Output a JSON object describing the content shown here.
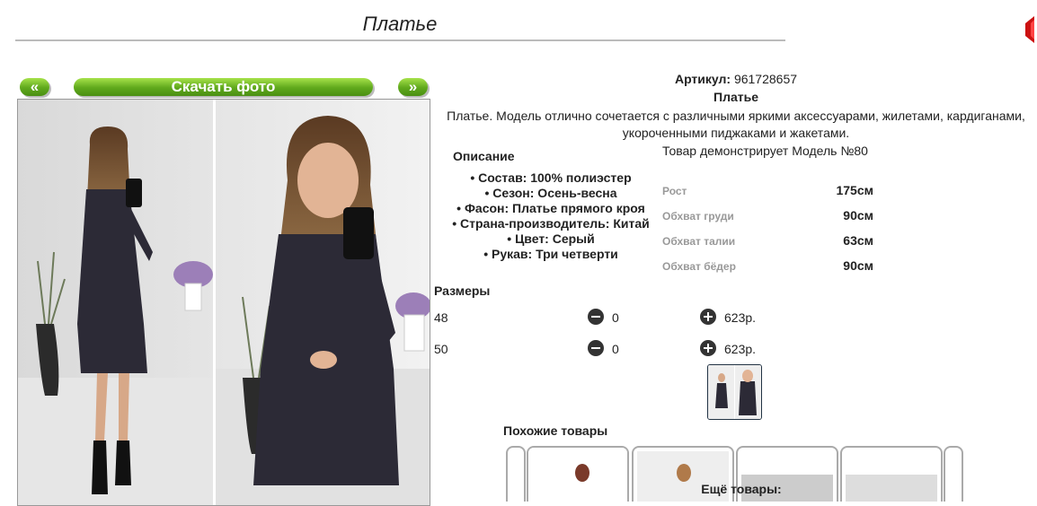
{
  "page": {
    "title": "Платье"
  },
  "gallery": {
    "prev_label": "«",
    "download_label": "Скачать фото",
    "next_label": "»"
  },
  "product": {
    "article_label": "Артикул:",
    "article_value": "961728657",
    "name": "Платье",
    "description_line1": "Платье. Модель отлично сочетается с различными яркими аксессуарами, жилетами, кардиганами,",
    "description_line2": "укороченными пиджаками и жакетами."
  },
  "description": {
    "title": "Описание",
    "items": [
      "Состав: 100% полиэстер",
      "Сезон: Осень-весна",
      "Фасон: Платье прямого кроя",
      "Страна-производитель: Китай",
      "Цвет: Серый",
      "Рукав: Три четверти"
    ]
  },
  "model": {
    "title": "Товар демонстрирует Модель №80",
    "rows": [
      {
        "label": "Рост",
        "value": "175см"
      },
      {
        "label": "Обхват груди",
        "value": "90см"
      },
      {
        "label": "Обхват талии",
        "value": "63см"
      },
      {
        "label": "Обхват бёдер",
        "value": "90см"
      }
    ]
  },
  "sizes": {
    "title": "Размеры",
    "rows": [
      {
        "size": "48",
        "qty": "0",
        "price": "623р."
      },
      {
        "size": "50",
        "qty": "0",
        "price": "623р."
      }
    ]
  },
  "similar": {
    "title": "Похожие товары"
  },
  "more": {
    "title": "Ещё товары:"
  },
  "icons": [
    "minus-circle-icon",
    "plus-circle-icon",
    "bullet-icon"
  ],
  "colors": {
    "accent_green": "#5fa81c",
    "corner_red": "#cc1111"
  }
}
